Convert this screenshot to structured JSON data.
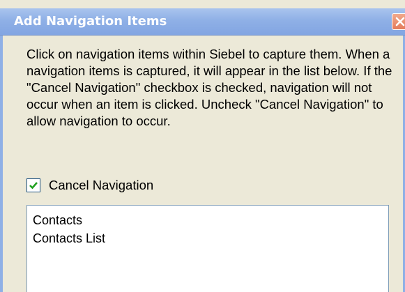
{
  "dialog": {
    "title": "Add Navigation Items",
    "close_icon": "close-icon"
  },
  "instructions": "Click on navigation items within Siebel to capture them. When a navigation items is captured, it will appear in the list below. If the \"Cancel Navigation\" checkbox is checked, navigation will not occur when an item is clicked. Uncheck \"Cancel Navigation\" to allow navigation to occur.",
  "cancel_navigation": {
    "label": "Cancel Navigation",
    "checked": true
  },
  "captured_items": [
    {
      "label": "Contacts"
    },
    {
      "label": "Contacts List"
    }
  ],
  "colors": {
    "titlebar": "#8fb0e6",
    "dialog_background": "#ece9d8",
    "checkmark": "#21a121"
  }
}
